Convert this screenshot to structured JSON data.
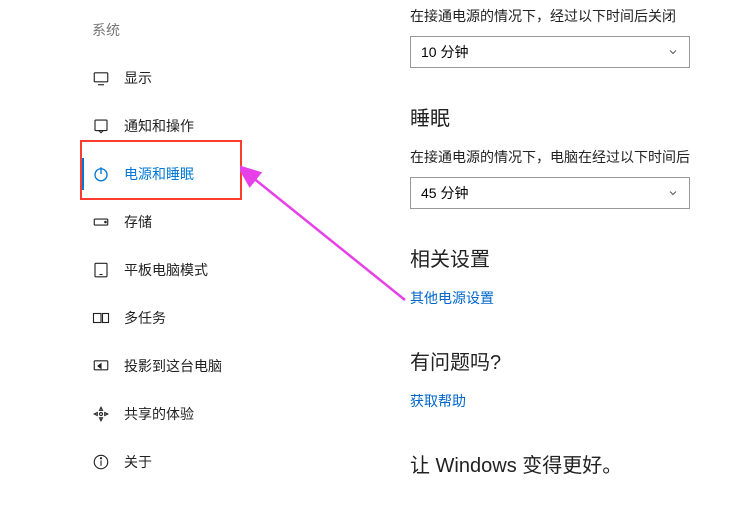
{
  "sidebar": {
    "header": "系统",
    "items": [
      {
        "label": "显示"
      },
      {
        "label": "通知和操作"
      },
      {
        "label": "电源和睡眠"
      },
      {
        "label": "存储"
      },
      {
        "label": "平板电脑模式"
      },
      {
        "label": "多任务"
      },
      {
        "label": "投影到这台电脑"
      },
      {
        "label": "共享的体验"
      },
      {
        "label": "关于"
      }
    ]
  },
  "content": {
    "screen_off_label": "在接通电源的情况下，经过以下时间后关闭",
    "screen_off_value": "10 分钟",
    "sleep_title": "睡眠",
    "sleep_label": "在接通电源的情况下，电脑在经过以下时间后",
    "sleep_value": "45 分钟",
    "related_title": "相关设置",
    "related_link": "其他电源设置",
    "help_title": "有问题吗?",
    "help_link": "获取帮助",
    "feedback_title": "让 Windows 变得更好。"
  }
}
